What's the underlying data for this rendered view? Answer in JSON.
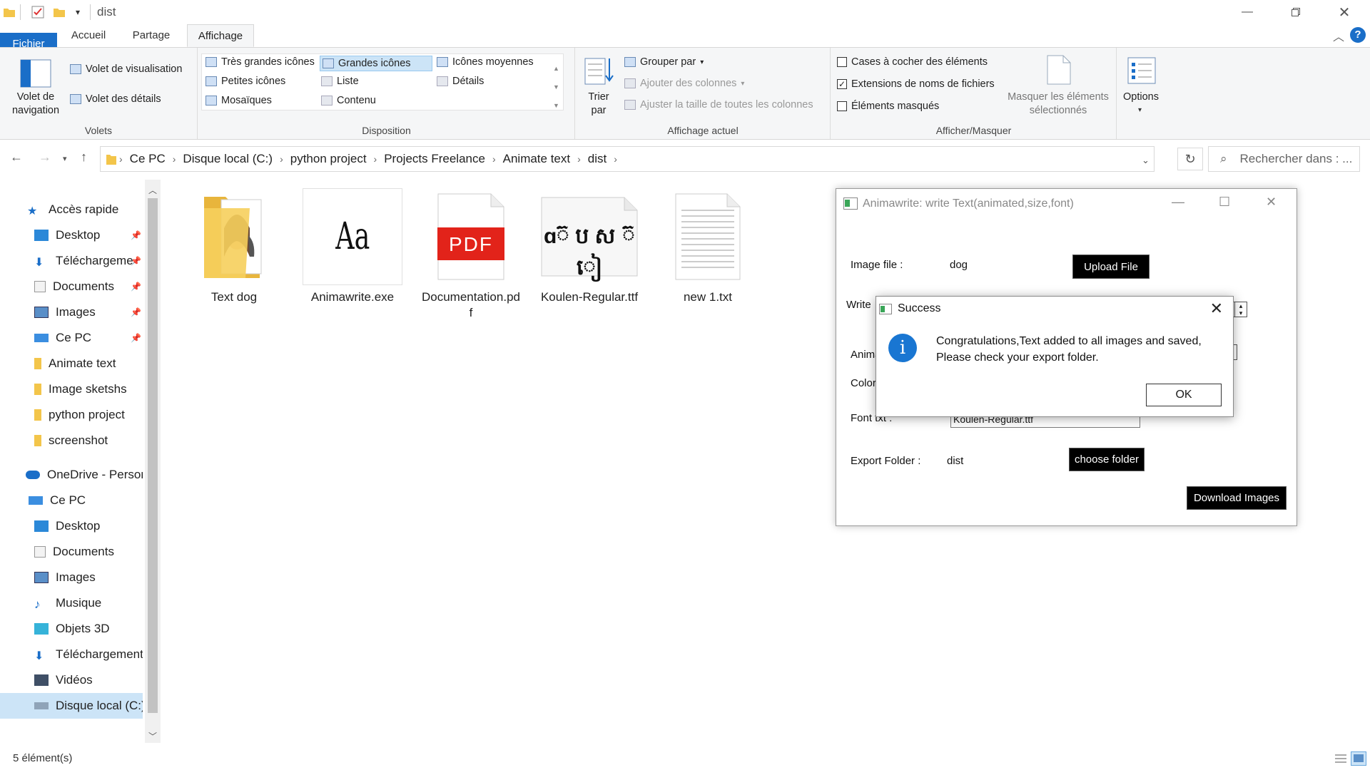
{
  "titlebar": {
    "title": "dist",
    "qa_dropdown": "▾"
  },
  "ribbon_tabs": [
    "Fichier",
    "Accueil",
    "Partage",
    "Affichage"
  ],
  "ribbon": {
    "volets": {
      "label": "Volets",
      "nav_pane": "Volet de navigation",
      "preview_pane": "Volet de visualisation",
      "details_pane": "Volet des détails"
    },
    "disposition": {
      "label": "Disposition",
      "items": [
        "Très grandes icônes",
        "Grandes icônes",
        "Icônes moyennes",
        "Petites icônes",
        "Liste",
        "Détails",
        "Mosaïques",
        "Contenu"
      ],
      "selected": "Grandes icônes"
    },
    "affichage_actuel": {
      "label": "Affichage actuel",
      "sort": "Trier par",
      "group": "Grouper par",
      "add_columns": "Ajouter des colonnes",
      "fit_columns": "Ajuster la taille de toutes les colonnes"
    },
    "afficher_masquer": {
      "label": "Afficher/Masquer",
      "checkboxes": "Cases à cocher des éléments",
      "extensions": "Extensions de noms de fichiers",
      "hidden": "Éléments masqués",
      "hide_selected": "Masquer les éléments sélectionnés"
    },
    "options": "Options"
  },
  "address": {
    "crumbs": [
      "Ce PC",
      "Disque local (C:)",
      "python project",
      "Projects Freelance",
      "Animate text",
      "dist"
    ],
    "search_placeholder": "Rechercher dans : ..."
  },
  "nav": {
    "quick_access": "Accès rapide",
    "quick_items": [
      "Desktop",
      "Téléchargeme",
      "Documents",
      "Images",
      "Ce PC",
      "Animate text",
      "Image sketshs",
      "python project",
      "screenshot"
    ],
    "onedrive": "OneDrive - Person",
    "this_pc": "Ce PC",
    "pc_items": [
      "Desktop",
      "Documents",
      "Images",
      "Musique",
      "Objets 3D",
      "Téléchargements",
      "Vidéos",
      "Disque local (C:)"
    ]
  },
  "files": [
    {
      "name": "Text dog",
      "type": "folder"
    },
    {
      "name": "Animawrite.exe",
      "type": "exe",
      "glyph": "Aa"
    },
    {
      "name": "Documentation.pdf",
      "type": "pdf",
      "glyph": "PDF"
    },
    {
      "name": "Koulen-Regular.ttf",
      "type": "font",
      "glyph": "ɑ៊ ប ស ៊ ៀ"
    },
    {
      "name": "new 1.txt",
      "type": "txt"
    }
  ],
  "status": {
    "count": "5 élément(s)"
  },
  "app": {
    "title": "Animawrite: write Text(animated,size,font)",
    "image_file_label": "Image file :",
    "image_file_value": "dog",
    "upload_btn": "Upload File",
    "write_label": "Write",
    "anim_label": "Anima",
    "color_label": "Color",
    "font_label": "Font txt :",
    "font_value": "Koulen-Regular.ttf",
    "export_label": "Export Folder :",
    "export_value": "dist",
    "choose_btn": "choose folder",
    "download_btn": "Download Images"
  },
  "dialog": {
    "title": "Success",
    "line1": "Congratulations,Text added to all images and saved,",
    "line2": "Please check your export folder.",
    "ok": "OK"
  },
  "colors": {
    "accent": "#1a6ec8",
    "selection": "#cce4f7",
    "info": "#1976d2",
    "pdf_red": "#e2231a"
  }
}
